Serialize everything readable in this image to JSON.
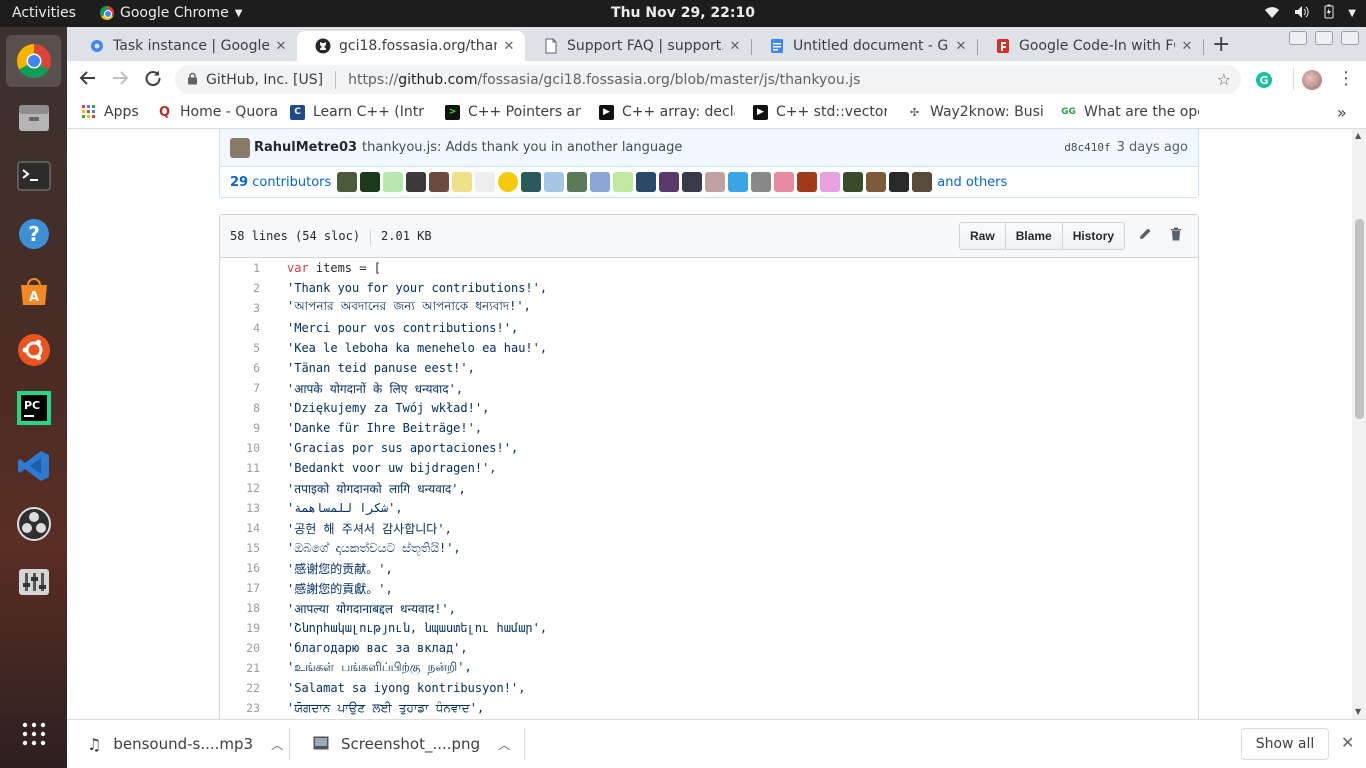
{
  "topbar": {
    "activities": "Activities",
    "app_name": "Google Chrome",
    "clock": "Thu Nov 29, 22:10"
  },
  "dock": {
    "items": [
      "chrome-icon",
      "files-icon",
      "terminal-icon",
      "help-icon",
      "software-center-icon",
      "ubuntu-icon",
      "pycharm-icon",
      "vscode-icon",
      "obs-icon",
      "mixer-icon",
      "show-apps-icon"
    ]
  },
  "tabs": [
    {
      "title": "Task instance | Google C",
      "active": false
    },
    {
      "title": "gci18.fossasia.org/than",
      "active": true
    },
    {
      "title": "Support FAQ | support.c",
      "active": false
    },
    {
      "title": "Untitled document - Go",
      "active": false
    },
    {
      "title": "Google Code-In with FO",
      "active": false
    }
  ],
  "omnibox": {
    "site_identity": "GitHub, Inc. [US]",
    "url_scheme": "https://",
    "url_host": "github.com",
    "url_path": "/fossasia/gci18.fossasia.org/blob/master/js/thankyou.js"
  },
  "bookmarks": [
    {
      "label": "Apps"
    },
    {
      "label": "Home - Quora"
    },
    {
      "label": "Learn C++ (Intro"
    },
    {
      "label": "C++ Pointers and"
    },
    {
      "label": "C++ array: declar"
    },
    {
      "label": "C++ std::vector :"
    },
    {
      "label": "Way2know: Busi"
    },
    {
      "label": "What are the ope"
    }
  ],
  "commit": {
    "author": "RahulMetre03",
    "message": "thankyou.js: Adds thank you in another language",
    "sha": "d8c410f",
    "ago": "3 days ago",
    "contributors_count": "29",
    "contributors_label": "contributors",
    "and_others": "and others"
  },
  "file": {
    "lines_info": "58 lines (54 sloc)",
    "size": "2.01 KB",
    "raw": "Raw",
    "blame": "Blame",
    "history": "History"
  },
  "code_lines": [
    {
      "n": "1",
      "keyword": "var",
      "rest": " items = ["
    },
    {
      "n": "2",
      "text": "'Thank you for your contributions!',"
    },
    {
      "n": "3",
      "text": "'আপনার অবদানের জন্য আপনাকে ধন্যবাদ!',"
    },
    {
      "n": "4",
      "text": "'Merci pour vos contributions!',"
    },
    {
      "n": "5",
      "text": "'Kea le leboha ka menehelo ea hau!',"
    },
    {
      "n": "6",
      "text": "'Tänan teid panuse eest!',"
    },
    {
      "n": "7",
      "text": "'आपके योगदानों के लिए धन्यवाद',"
    },
    {
      "n": "8",
      "text": "'Dziękujemy za Twój wkład!',"
    },
    {
      "n": "9",
      "text": "'Danke für Ihre Beiträge!',"
    },
    {
      "n": "10",
      "text": "'Gracias por sus aportaciones!',"
    },
    {
      "n": "11",
      "text": "'Bedankt voor uw bijdragen!',"
    },
    {
      "n": "12",
      "text": "'तपाइको योगदानको लागि धन्यवाद',"
    },
    {
      "n": "13",
      "text": "'شكرا للمساهمة',"
    },
    {
      "n": "14",
      "text": "'공헌 해 주셔서 감사합니다',"
    },
    {
      "n": "15",
      "text": "'ඔබගේ දායකත්වයට ස්තූතියි!',"
    },
    {
      "n": "16",
      "text": "'感谢您的贡献。',"
    },
    {
      "n": "17",
      "text": "'感謝您的貢獻。',"
    },
    {
      "n": "18",
      "text": "'आपल्या योगदानाबद्दल धन्यवाद!',"
    },
    {
      "n": "19",
      "text": "'Շնորհակալություն, նպաստելու համար',"
    },
    {
      "n": "20",
      "text": "'благодарю вас за вклад',"
    },
    {
      "n": "21",
      "text": "'உங்கள் பங்களிப்பிற்கு நன்றி',"
    },
    {
      "n": "22",
      "text": "'Salamat sa iyong kontribusyon!',"
    },
    {
      "n": "23",
      "text": "'ਯੋਗਦਾਨ ਪਾਉਣ ਲਈ ਤੁਹਾਡਾ ਧੰਨਵਾਦ',"
    }
  ],
  "downloads": [
    {
      "name": "bensound-s....mp3"
    },
    {
      "name": "Screenshot_....png"
    }
  ],
  "downloads_show_all": "Show all",
  "colors": {
    "github_link": "#0366d6",
    "string": "#032f62",
    "keyword": "#d73a49",
    "commit_bg": "#f1f8ff"
  }
}
